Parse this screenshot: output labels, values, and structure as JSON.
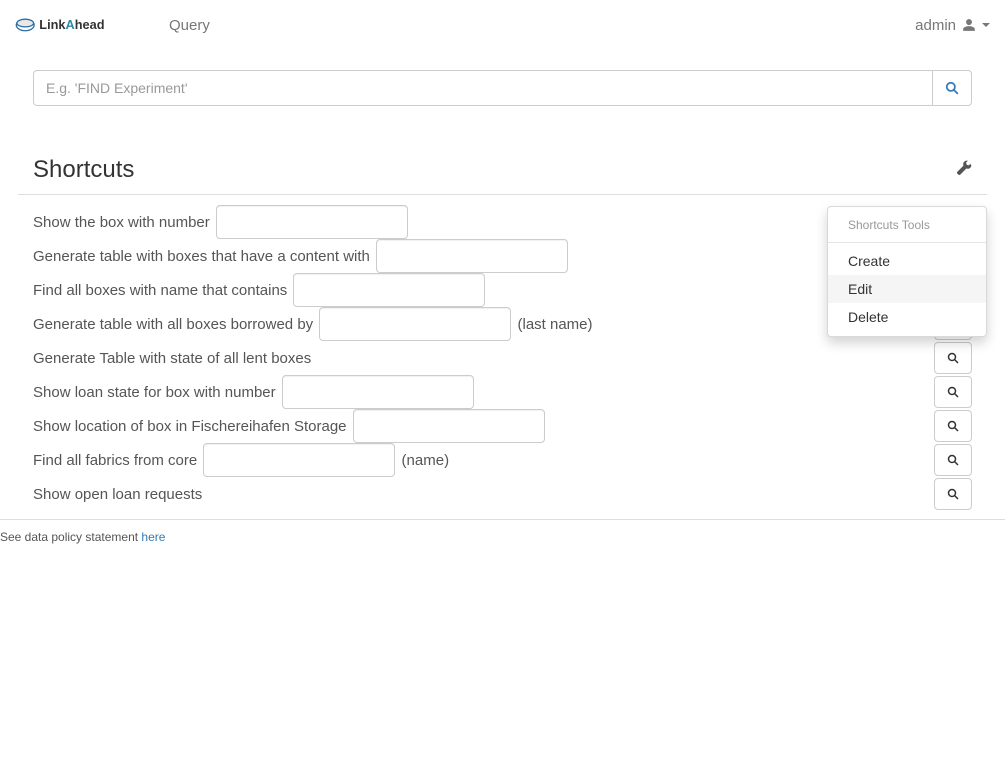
{
  "navbar": {
    "logo_text_a": "Link",
    "logo_text_b": "A",
    "logo_text_c": "head",
    "query_link": "Query",
    "user_name": "admin"
  },
  "search": {
    "placeholder": "E.g. 'FIND Experiment'"
  },
  "shortcuts": {
    "title": "Shortcuts",
    "rows": [
      {
        "pre": "Show the box with number ",
        "post": "",
        "has_input": true,
        "has_btn": false
      },
      {
        "pre": "Generate table with boxes that have a content with ",
        "post": "",
        "has_input": true,
        "has_btn": false
      },
      {
        "pre": "Find all boxes with name that contains ",
        "post": "",
        "has_input": true,
        "has_btn": false
      },
      {
        "pre": "Generate table with all boxes borrowed by ",
        "post": " (last name)",
        "has_input": true,
        "has_btn": true
      },
      {
        "pre": "Generate Table with state of all lent boxes",
        "post": "",
        "has_input": false,
        "has_btn": true
      },
      {
        "pre": "Show loan state for box with number ",
        "post": "",
        "has_input": true,
        "has_btn": true
      },
      {
        "pre": "Show location of box in Fischereihafen Storage ",
        "post": "",
        "has_input": true,
        "has_btn": true
      },
      {
        "pre": "Find all fabrics from core ",
        "post": " (name)",
        "has_input": true,
        "has_btn": true
      },
      {
        "pre": "Show open loan requests",
        "post": "",
        "has_input": false,
        "has_btn": true
      }
    ]
  },
  "tools_menu": {
    "header": "Shortcuts Tools",
    "items": [
      "Create",
      "Edit",
      "Delete"
    ],
    "hover_index": 1
  },
  "footer": {
    "text": "See data policy statement ",
    "link": "here"
  },
  "colors": {
    "link": "#337ab7",
    "text_muted": "#777",
    "border": "#ccc"
  }
}
